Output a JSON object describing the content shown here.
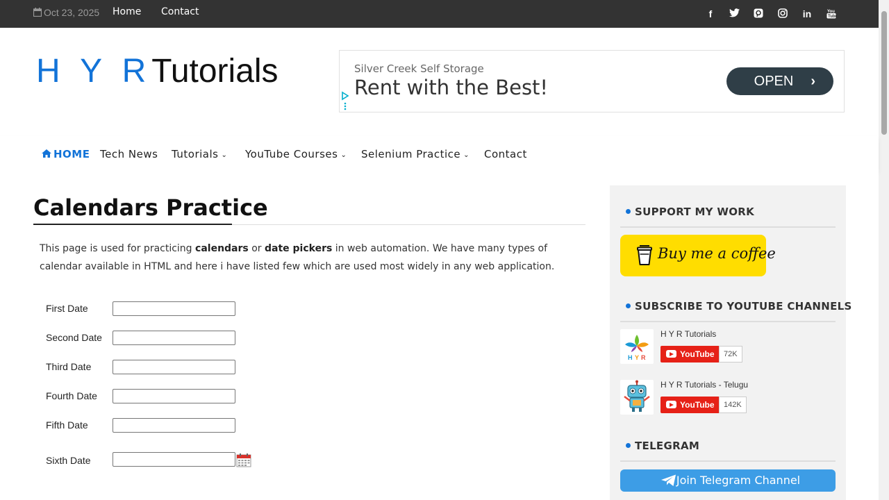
{
  "topbar": {
    "date": "Oct 23, 2025",
    "links": [
      "Home",
      "Contact"
    ],
    "social_icons": [
      "facebook-icon",
      "twitter-icon",
      "pinterest-icon",
      "instagram-icon",
      "linkedin-icon",
      "youtube-icon"
    ]
  },
  "header": {
    "logo_hyr": "H Y R",
    "logo_tutorials": "Tutorials"
  },
  "ad": {
    "advertiser": "Silver Creek Self Storage",
    "headline": "Rent with the Best!",
    "button": "OPEN"
  },
  "nav": {
    "items": [
      {
        "label": "HOME",
        "active": true,
        "dropdown": false
      },
      {
        "label": "Tech News",
        "active": false,
        "dropdown": false
      },
      {
        "label": "Tutorials",
        "active": false,
        "dropdown": true
      },
      {
        "label": "YouTube Courses",
        "active": false,
        "dropdown": true
      },
      {
        "label": "Selenium Practice",
        "active": false,
        "dropdown": true
      },
      {
        "label": "Contact",
        "active": false,
        "dropdown": false
      }
    ]
  },
  "main": {
    "title": "Calendars Practice",
    "intro_parts": {
      "p1": "This page is used for practicing ",
      "b1": "calendars",
      "p2": " or ",
      "b2": "date pickers",
      "p3": " in web automation. We have many types of calendar available in HTML and here i have listed few which are used most widely in any web application."
    },
    "fields": [
      {
        "label": "First Date",
        "value": ""
      },
      {
        "label": "Second Date",
        "value": ""
      },
      {
        "label": "Third Date",
        "value": ""
      },
      {
        "label": "Fourth Date",
        "value": ""
      },
      {
        "label": "Fifth Date",
        "value": ""
      },
      {
        "label": "Sixth Date",
        "value": ""
      }
    ]
  },
  "sidebar": {
    "support_title": "SUPPORT MY WORK",
    "coffee_label": "Buy me a coffee",
    "subscribe_title": "SUBSCRIBE TO YOUTUBE CHANNELS",
    "channels": [
      {
        "name": "H Y R Tutorials",
        "button": "YouTube",
        "count": "72K"
      },
      {
        "name": "H Y R Tutorials - Telugu",
        "button": "YouTube",
        "count": "142K"
      }
    ],
    "telegram_title": "TELEGRAM",
    "telegram_button": "Join Telegram Channel"
  },
  "colors": {
    "accent": "#1273d8",
    "topbar": "#333333",
    "coffee": "#ffdd00",
    "youtube": "#e62117",
    "telegram": "#3d9de6"
  }
}
